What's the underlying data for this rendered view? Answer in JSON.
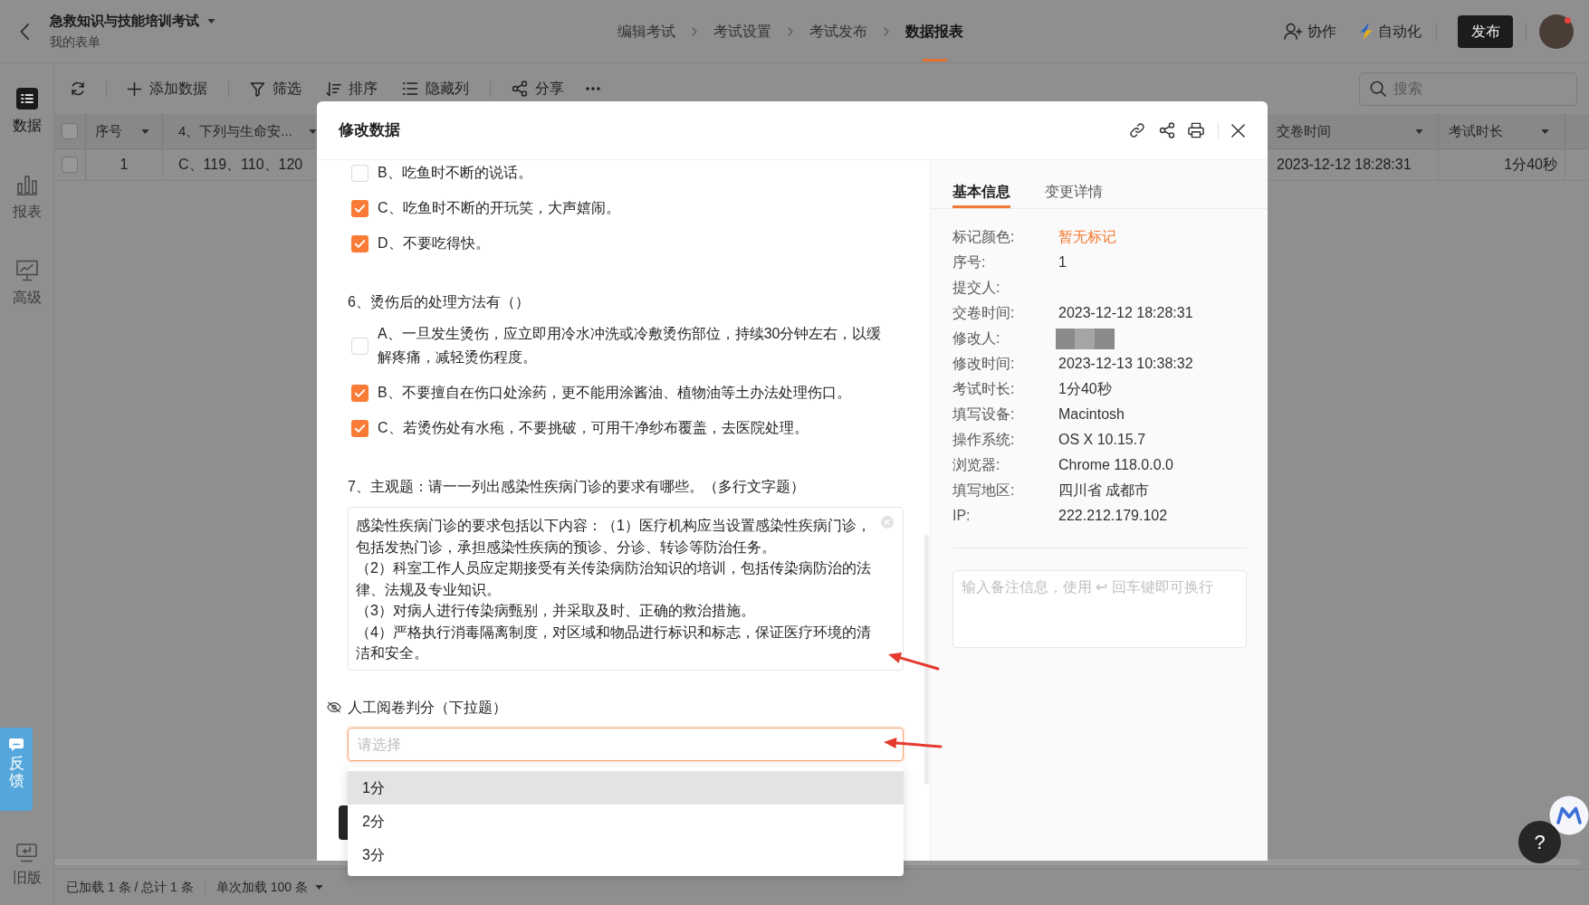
{
  "header": {
    "title": "急救知识与技能培训考试",
    "subtitle": "我的表单",
    "steps": [
      {
        "label": "编辑考试",
        "selected": false
      },
      {
        "label": "考试设置",
        "selected": false
      },
      {
        "label": "考试发布",
        "selected": false
      },
      {
        "label": "数据报表",
        "selected": true
      }
    ],
    "actions": [
      {
        "kind": "collaborate",
        "label": "协作"
      },
      {
        "kind": "automation",
        "label": "自动化"
      }
    ],
    "publish_button": "发布"
  },
  "sidebar": {
    "items": [
      {
        "kind": "data",
        "label": "数据",
        "selected": true
      },
      {
        "kind": "report",
        "label": "报表",
        "selected": false
      },
      {
        "kind": "advanced",
        "label": "高级",
        "selected": false
      }
    ],
    "feedback": "反馈",
    "legacy": "旧版"
  },
  "toolbar": {
    "groups": [
      [
        {
          "kind": "add",
          "label": "添加数据"
        }
      ],
      [
        {
          "kind": "filter",
          "label": "筛选"
        },
        {
          "kind": "sort",
          "label": "排序"
        },
        {
          "kind": "columns",
          "label": "隐藏列"
        }
      ],
      [
        {
          "kind": "share",
          "label": "分享"
        }
      ]
    ],
    "search": {
      "placeholder": "搜索"
    }
  },
  "table": {
    "select_all": false,
    "columns": [
      "序号",
      "4、下列与生命安...",
      "交卷时间",
      "考试时长"
    ],
    "rows": [
      {
        "checked": false,
        "cells": [
          "1",
          "C、119、110、120",
          "2023-12-12 18:28:31",
          "1分40秒"
        ]
      }
    ]
  },
  "status_bar": {
    "loaded": "已加载 1 条 / 总计 1 条",
    "page_size": "单次加载 100 条"
  },
  "modal": {
    "title": "修改数据",
    "questions": [
      {
        "kind": "choice",
        "options": [
          {
            "label": "B、吃鱼时不断的说话。",
            "checked": false
          },
          {
            "label": "C、吃鱼时不断的开玩笑，大声嬉闹。",
            "checked": true
          },
          {
            "label": "D、不要吃得快。",
            "checked": true
          }
        ]
      },
      {
        "kind": "choice",
        "title": "6、烫伤后的处理方法有（）",
        "options": [
          {
            "label": "A、一旦发生烫伤，应立即用冷水冲洗或冷敷烫伤部位，持续30分钟左右，以缓解疼痛，减轻烫伤程度。",
            "checked": false
          },
          {
            "label": "B、不要擅自在伤口处涂药，更不能用涂酱油、植物油等土办法处理伤口。",
            "checked": true
          },
          {
            "label": "C、若烫伤处有水疱，不要挑破，可用干净纱布覆盖，去医院处理。",
            "checked": true
          }
        ]
      },
      {
        "kind": "textarea",
        "title": "7、主观题：请一一列出感染性疾病门诊的要求有哪些。（多行文字题）",
        "paragraphs": [
          "感染性疾病门诊的要求包括以下内容：（1）医疗机构应当设置感染性疾病门诊，包括发热门诊，承担感染性疾病的预诊、分诊、转诊等防治任务。",
          "（2）科室工作人员应定期接受有关传染病防治知识的培训，包括传染病防治的法律、法规及专业知识。",
          "（3）对病人进行传染病甄别，并采取及时、正确的救治措施。",
          "（4）严格执行消毒隔离制度，对区域和物品进行标识和标志，保证医疗环境的清洁和安全。"
        ]
      },
      {
        "kind": "select",
        "title": "人工阅卷判分（下拉题）",
        "hidden": true,
        "placeholder": "请选择",
        "expanded": true,
        "options": [
          {
            "label": "1分",
            "highlighted": true
          },
          {
            "label": "2分",
            "highlighted": false
          },
          {
            "label": "3分",
            "highlighted": false
          }
        ]
      }
    ],
    "tabs": [
      {
        "label": "基本信息",
        "selected": true
      },
      {
        "label": "变更详情",
        "selected": false
      }
    ],
    "info": [
      {
        "label": "标记颜色:",
        "value": "暂无标记",
        "kind": "mark"
      },
      {
        "label": "序号:",
        "value": "1",
        "kind": "text"
      },
      {
        "label": "提交人:",
        "kind": "text"
      },
      {
        "label": "交卷时间:",
        "value": "2023-12-12 18:28:31",
        "kind": "text"
      },
      {
        "label": "修改人:",
        "kind": "redacted"
      },
      {
        "label": "修改时间:",
        "value": "2023-12-13 10:38:32",
        "kind": "text"
      },
      {
        "label": "考试时长:",
        "value": "1分40秒",
        "kind": "text"
      },
      {
        "label": "填写设备:",
        "value": "Macintosh",
        "kind": "text"
      },
      {
        "label": "操作系统:",
        "value": "OS X 10.15.7",
        "kind": "text"
      },
      {
        "label": "浏览器:",
        "value": "Chrome 118.0.0.0",
        "kind": "text"
      },
      {
        "label": "填写地区:",
        "value": "四川省 成都市",
        "kind": "text"
      },
      {
        "label": "IP:",
        "value": "222.212.179.102",
        "kind": "text"
      }
    ],
    "remark": {
      "placeholder": "输入备注信息，使用 ↩ 回车键即可换行"
    }
  },
  "annotations": [
    {
      "kind": "arrow"
    },
    {
      "kind": "arrow"
    }
  ],
  "help_button": "?"
}
